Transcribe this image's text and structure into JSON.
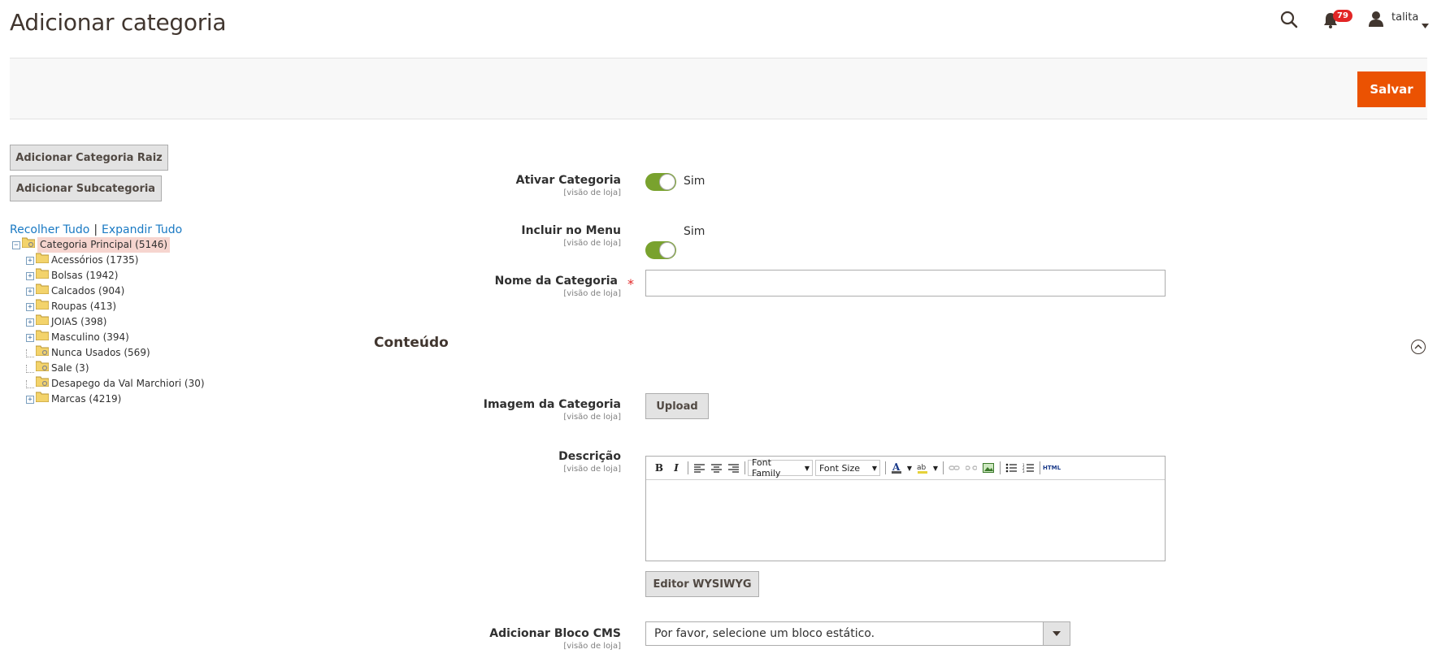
{
  "header": {
    "title": "Adicionar categoria",
    "notifications_count": "79",
    "user_name": "talita"
  },
  "actions": {
    "save_label": "Salvar"
  },
  "tree_panel": {
    "add_root_label": "Adicionar Categoria Raiz",
    "add_sub_label": "Adicionar Subcategoria",
    "collapse_all": "Recolher Tudo",
    "separator": "|",
    "expand_all": "Expandir Tudo",
    "root": "Categoria Principal (5146)",
    "items": [
      {
        "label": "Acessórios (1735)",
        "expandable": true
      },
      {
        "label": "Bolsas (1942)",
        "expandable": true
      },
      {
        "label": "Calcados (904)",
        "expandable": true
      },
      {
        "label": "Roupas (413)",
        "expandable": true
      },
      {
        "label": "JOIAS (398)",
        "expandable": true
      },
      {
        "label": "Masculino (394)",
        "expandable": true
      },
      {
        "label": "Nunca Usados (569)",
        "expandable": false
      },
      {
        "label": "Sale (3)",
        "expandable": false
      },
      {
        "label": "Desapego da Val Marchiori (30)",
        "expandable": false
      },
      {
        "label": "Marcas (4219)",
        "expandable": true
      }
    ]
  },
  "form": {
    "scope_text": "[visão de loja]",
    "enable_label": "Ativar Categoria",
    "enable_value": "Sim",
    "menu_label": "Incluir no Menu",
    "menu_value": "Sim",
    "name_label": "Nome da Categoria",
    "name_required": "*",
    "name_value": ""
  },
  "content_section": {
    "title": "Conteúdo",
    "image_label": "Imagem da Categoria",
    "upload_label": "Upload",
    "description_label": "Descrição",
    "font_family": "Font Family",
    "font_size": "Font Size",
    "html_label": "HTML",
    "wysiwyg_label": "Editor WYSIWYG",
    "cms_label": "Adicionar Bloco CMS",
    "cms_value": "Por favor, selecione um bloco estático."
  },
  "colors": {
    "accent": "#eb5202",
    "toggle_on": "#79a22e",
    "link": "#1979c3",
    "badge": "#e22626"
  }
}
